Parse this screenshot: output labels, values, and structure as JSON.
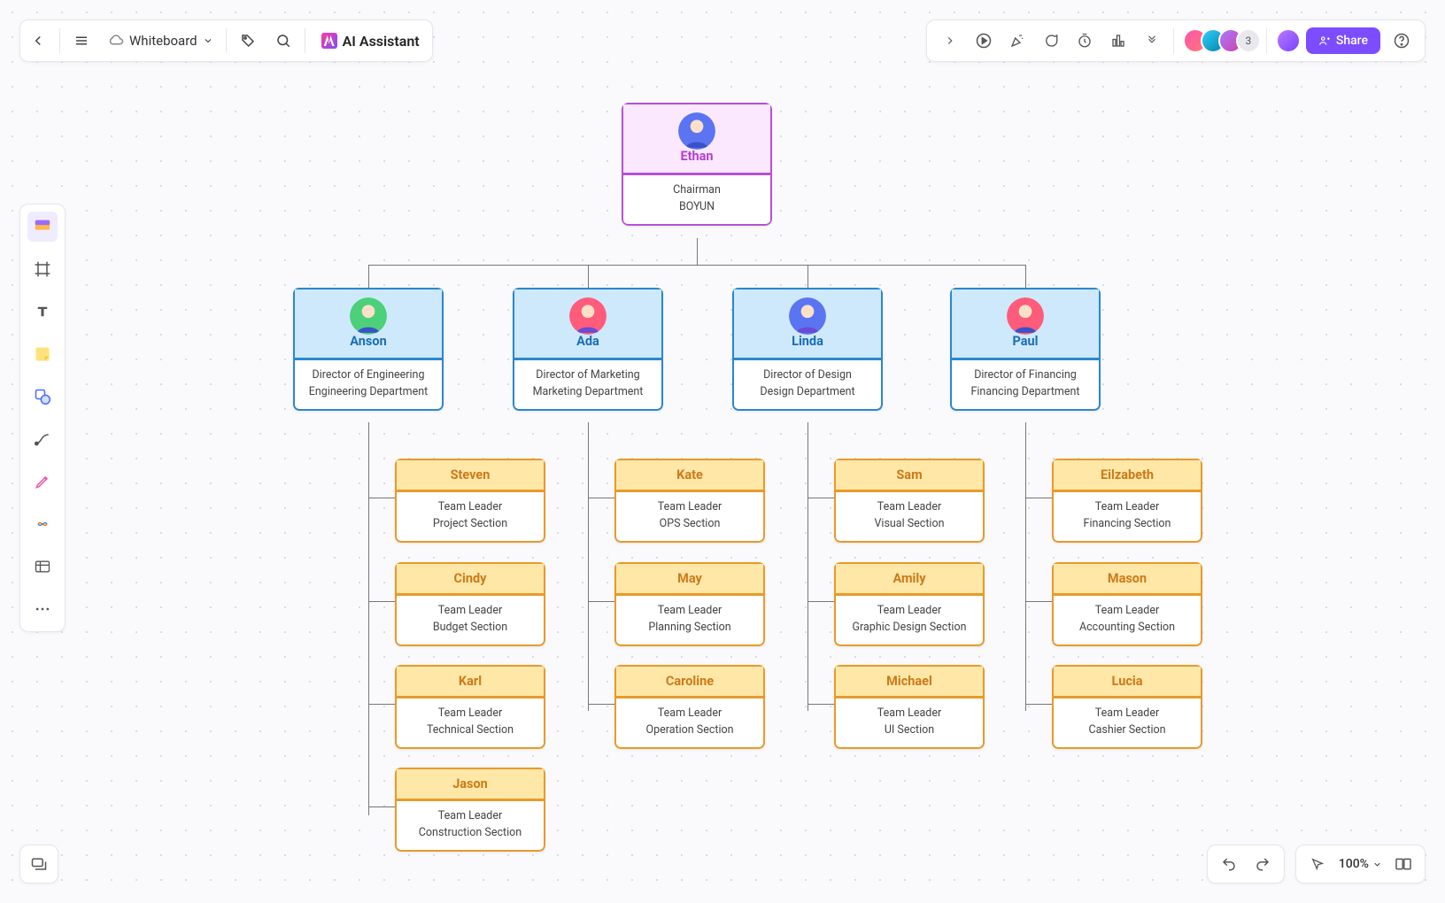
{
  "top": {
    "doc_name": "Whiteboard",
    "ai_label": "AI Assistant"
  },
  "right": {
    "share_label": "Share",
    "extra_count": "3"
  },
  "bottom": {
    "zoom": "100%"
  },
  "org": {
    "root": {
      "name": "Ethan",
      "title": "Chairman",
      "dept": "BOYUN",
      "avatar_bg": "#5a74f2"
    },
    "directors": [
      {
        "name": "Anson",
        "title": "Director of Engineering",
        "dept": "Engineering Department",
        "avatar_bg": "#4cd07a"
      },
      {
        "name": "Ada",
        "title": "Director of Marketing",
        "dept": "Marketing Department",
        "avatar_bg": "#ff5b7a"
      },
      {
        "name": "Linda",
        "title": "Director of Design",
        "dept": "Design Department",
        "avatar_bg": "#5a74f2"
      },
      {
        "name": "Paul",
        "title": "Director of Financing",
        "dept": "Financing Department",
        "avatar_bg": "#ff5b7a"
      }
    ],
    "teams": {
      "anson": [
        {
          "name": "Steven",
          "title": "Team Leader",
          "section": "Project Section"
        },
        {
          "name": "Cindy",
          "title": "Team Leader",
          "section": "Budget Section"
        },
        {
          "name": "Karl",
          "title": "Team Leader",
          "section": "Technical Section"
        },
        {
          "name": "Jason",
          "title": "Team Leader",
          "section": "Construction Section"
        }
      ],
      "ada": [
        {
          "name": "Kate",
          "title": "Team Leader",
          "section": "OPS Section"
        },
        {
          "name": "May",
          "title": "Team Leader",
          "section": "Planning Section"
        },
        {
          "name": "Caroline",
          "title": "Team Leader",
          "section": "Operation Section"
        }
      ],
      "linda": [
        {
          "name": "Sam",
          "title": "Team Leader",
          "section": "Visual Section"
        },
        {
          "name": "Amily",
          "title": "Team Leader",
          "section": "Graphic Design Section"
        },
        {
          "name": "Michael",
          "title": "Team Leader",
          "section": "UI Section"
        }
      ],
      "paul": [
        {
          "name": "Eilzabeth",
          "title": "Team Leader",
          "section": "Financing Section"
        },
        {
          "name": "Mason",
          "title": "Team Leader",
          "section": "Accounting Section"
        },
        {
          "name": "Lucia",
          "title": "Team Leader",
          "section": "Cashier Section"
        }
      ]
    }
  }
}
